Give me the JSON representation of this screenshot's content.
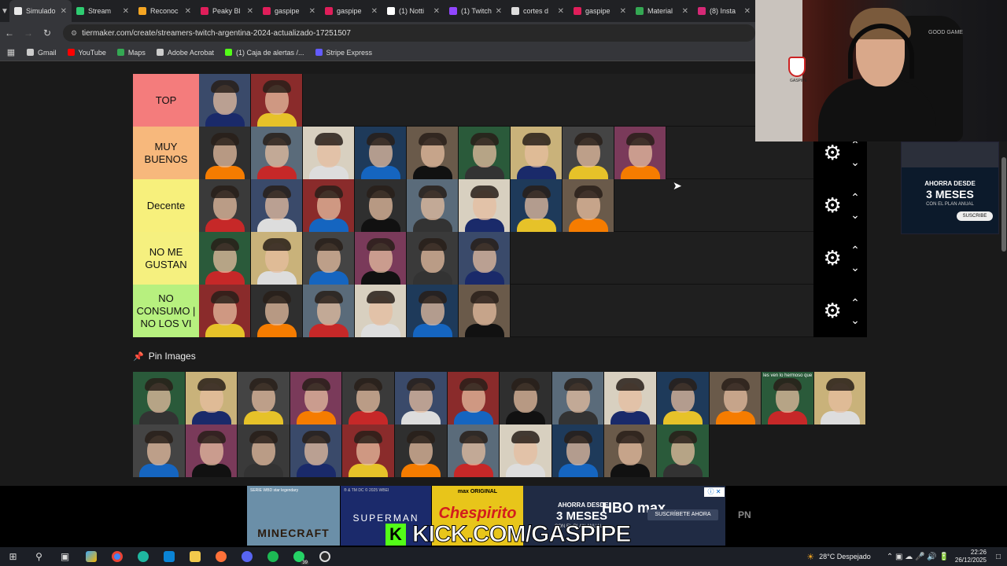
{
  "browser": {
    "tabs": [
      {
        "label": "Simulado",
        "color": "#e8e8e8",
        "active": true
      },
      {
        "label": "Stream",
        "color": "#2ecc71"
      },
      {
        "label": "Reconoc",
        "color": "#f5a623"
      },
      {
        "label": "Peaky Bl",
        "color": "#e01e5a"
      },
      {
        "label": "gaspipe",
        "color": "#e01e5a"
      },
      {
        "label": "gaspipe",
        "color": "#e01e5a"
      },
      {
        "label": "(1) Notti",
        "color": "#ffffff"
      },
      {
        "label": "(1) Twitch",
        "color": "#9146ff"
      },
      {
        "label": "cortes d",
        "color": "#dddddd"
      },
      {
        "label": "gaspipe",
        "color": "#e01e5a"
      },
      {
        "label": "Material",
        "color": "#34a853"
      },
      {
        "label": "(8) Insta",
        "color": "#d62976"
      }
    ],
    "url": "tiermaker.com/create/streamers-twitch-argentina-2024-actualizado-17251507",
    "bookmarks": [
      {
        "label": "Gmail",
        "color": "#cccccc"
      },
      {
        "label": "YouTube",
        "color": "#ff0000"
      },
      {
        "label": "Maps",
        "color": "#34a853"
      },
      {
        "label": "Adobe Acrobat",
        "color": "#cccccc"
      },
      {
        "label": "(1) Caja de alertas /...",
        "color": "#53fc18"
      },
      {
        "label": "Stripe Express",
        "color": "#635bff"
      }
    ]
  },
  "tierlist": {
    "tiers": [
      {
        "label": "TOP",
        "color": "#f47c7c",
        "count": 2
      },
      {
        "label": "MUY BUENOS",
        "color": "#f7b87c",
        "count": 9
      },
      {
        "label": "Decente",
        "color": "#f7f07c",
        "count": 8
      },
      {
        "label": "NO ME GUSTAN",
        "color": "#f5f07f",
        "count": 6
      },
      {
        "label": "NO CONSUMO | NO LOS VI",
        "color": "#b7f07f",
        "count": 6
      }
    ],
    "pin_title": "Pin Images",
    "pool_count": 25,
    "pool_caption": "les ven lo hermoso que"
  },
  "side_ad": {
    "line1": "AHORRA DESDE",
    "line2": "3 MESES",
    "line3": "CON EL PLAN ANUAL",
    "button": "SUSCRIBE"
  },
  "webcam": {
    "chair_text": "GOOD GAME",
    "crest_text": "GASPIPE"
  },
  "bottom_ads": {
    "ad1_small": "SERIE WBD star legendary",
    "ad1_title": "MINECRAFT",
    "ad2_small": "® & TM DC © 2025 WBEI",
    "ad2_title": "SUPERMAN",
    "ad3_small": "max ORIGINAL",
    "ad3_title": "Chespirito",
    "ad4_line1": "AHORRA DESDE",
    "ad4_line2": "3 MESES",
    "ad4_line3": "CON EL PLAN ANUAL",
    "ad4_logo": "HBO max",
    "ad4_button": "SUSCRÍBETE AHORA",
    "close": "ⓘ ✕",
    "pn": "PN",
    "kick": "KICK.COM/GASPIPE"
  },
  "taskbar": {
    "weather": "28°C  Despejado",
    "time": "22:26",
    "date": "26/12/2025",
    "whatsapp_badge": "39"
  }
}
